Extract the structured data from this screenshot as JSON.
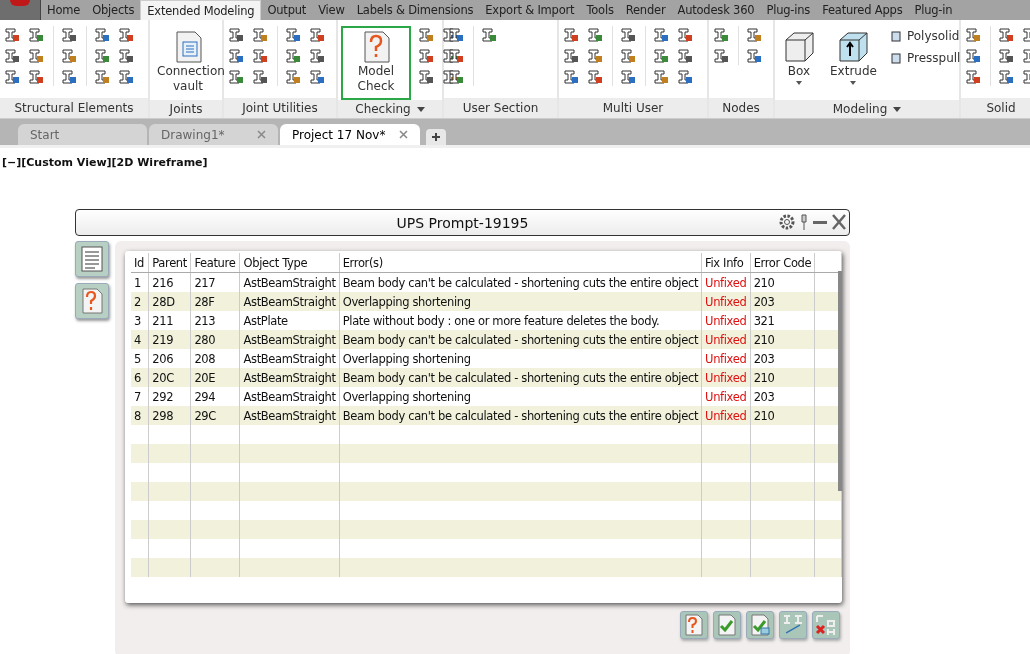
{
  "ribbon": {
    "tabs": [
      {
        "label": "Home",
        "selected": false
      },
      {
        "label": "Objects",
        "selected": false
      },
      {
        "label": "Extended Modeling",
        "selected": true
      },
      {
        "label": "Output",
        "selected": false
      },
      {
        "label": "View",
        "selected": false
      },
      {
        "label": "Labels & Dimensions",
        "selected": false
      },
      {
        "label": "Export & Import",
        "selected": false
      },
      {
        "label": "Tools",
        "selected": false
      },
      {
        "label": "Render",
        "selected": false
      },
      {
        "label": "Autodesk 360",
        "selected": false
      },
      {
        "label": "Plug-ins",
        "selected": false
      },
      {
        "label": "Featured Apps",
        "selected": false
      },
      {
        "label": "Plug-in",
        "selected": false
      }
    ],
    "panels": [
      {
        "title": "Structural Elements",
        "has_menu": false
      },
      {
        "title": "Joints",
        "has_menu": false,
        "large_buttons": [
          {
            "label": "Connection vault",
            "highlighted": false
          }
        ]
      },
      {
        "title": "Joint Utilities",
        "has_menu": false
      },
      {
        "title": "Checking",
        "has_menu": true,
        "large_buttons": [
          {
            "label": "Model Check",
            "highlighted": true
          }
        ]
      },
      {
        "title": "User Section",
        "has_menu": false
      },
      {
        "title": "Multi User",
        "has_menu": false
      },
      {
        "title": "Nodes",
        "has_menu": false
      },
      {
        "title": "Modeling",
        "has_menu": true,
        "large_buttons": [
          {
            "label": "Box",
            "highlighted": false
          },
          {
            "label": "Extrude",
            "highlighted": false
          }
        ],
        "small_buttons": [
          "Polysolid",
          "Presspull"
        ]
      },
      {
        "title": "Solid",
        "has_menu": false
      }
    ]
  },
  "doc_tabs": [
    {
      "label": "Start",
      "selected": false,
      "closable": false
    },
    {
      "label": "Drawing1*",
      "selected": false,
      "closable": true
    },
    {
      "label": "Project 17 Nov*",
      "selected": true,
      "closable": true
    }
  ],
  "viewport_label": "[−][Custom View][2D Wireframe]",
  "dialog": {
    "title": "UPS Prompt-19195",
    "table": {
      "columns": [
        "Id",
        "Parent",
        "Feature",
        "Object Type",
        "Error(s)",
        "Fix Info",
        "Error Code"
      ],
      "rows": [
        [
          "1",
          "216",
          "217",
          "AstBeamStraight",
          "Beam body can't be calculated - shortening cuts the entire object",
          "Unfixed",
          "210"
        ],
        [
          "2",
          "28D",
          "28F",
          "AstBeamStraight",
          "Overlapping shortening",
          "Unfixed",
          "203"
        ],
        [
          "3",
          "211",
          "213",
          "AstPlate",
          "Plate without body : one or more feature deletes the body.",
          "Unfixed",
          "321"
        ],
        [
          "4",
          "219",
          "280",
          "AstBeamStraight",
          "Beam body can't be calculated - shortening cuts the entire object",
          "Unfixed",
          "210"
        ],
        [
          "5",
          "206",
          "208",
          "AstBeamStraight",
          "Overlapping shortening",
          "Unfixed",
          "203"
        ],
        [
          "6",
          "20C",
          "20E",
          "AstBeamStraight",
          "Beam body can't be calculated - shortening cuts the entire object",
          "Unfixed",
          "210"
        ],
        [
          "7",
          "292",
          "294",
          "AstBeamStraight",
          "Overlapping shortening",
          "Unfixed",
          "203"
        ],
        [
          "8",
          "298",
          "29C",
          "AstBeamStraight",
          "Beam body can't be calculated - shortening cuts the entire object",
          "Unfixed",
          "210"
        ]
      ]
    }
  }
}
